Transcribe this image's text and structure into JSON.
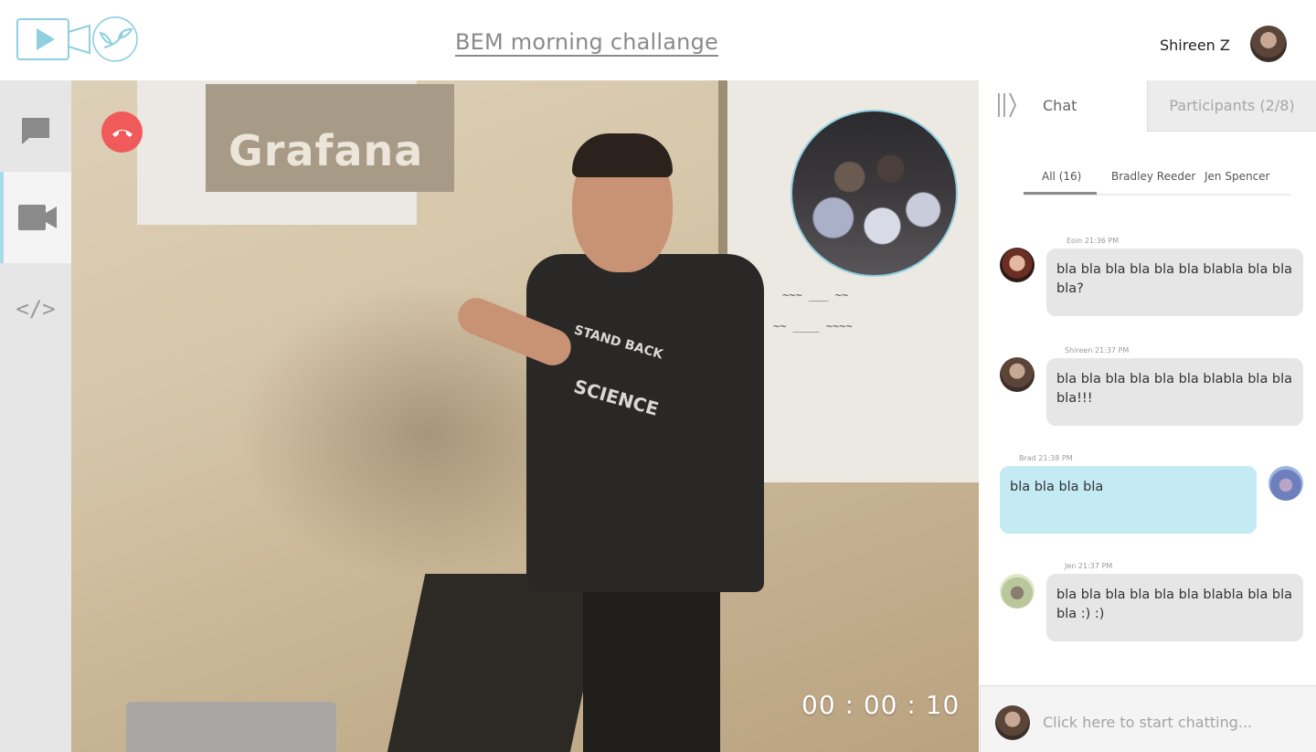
{
  "header": {
    "title": "BEM morning challange",
    "user_name": "Shireen Z"
  },
  "colors": {
    "accent": "#8ecfe0",
    "hangup": "#f05a5a",
    "outgoing_bubble": "#c4eaf3",
    "incoming_bubble": "#e6e6e6"
  },
  "rail": {
    "items": [
      {
        "name": "chat",
        "icon": "chat-bubble-icon"
      },
      {
        "name": "video",
        "icon": "video-camera-icon",
        "active": true
      },
      {
        "name": "code",
        "icon": "code-icon",
        "glyph": "</>"
      }
    ]
  },
  "stage": {
    "projection_text": "Grafana",
    "shirt_line1": "STAND BACK",
    "shirt_line2": "SCIENCE",
    "timer": "00 : 00 : 10"
  },
  "panel": {
    "tab_chat": "Chat",
    "tab_participants": "Participants (2/8)",
    "filters": {
      "all": "All (16)",
      "bradley": "Bradley Reeder",
      "jen": "Jen Spencer"
    },
    "messages": [
      {
        "author": "Eoin",
        "time": "21:36 PM",
        "meta": "Eoin  21:36 PM",
        "text": "bla bla bla  bla bla bla blabla bla bla bla?",
        "direction": "in"
      },
      {
        "author": "Shireen",
        "time": "21:37 PM",
        "meta": "Shireen  21:37 PM",
        "text": "bla bla bla  bla bla bla blabla bla bla bla!!!",
        "direction": "in"
      },
      {
        "author": "Brad",
        "time": "21:38 PM",
        "meta": "Brad  21:38 PM",
        "text": "bla bla bla bla",
        "direction": "out"
      },
      {
        "author": "Jen",
        "time": "21:37 PM",
        "meta": "Jen  21:37 PM",
        "text": "bla bla bla  bla bla bla blabla bla bla bla :) :)",
        "direction": "in"
      }
    ],
    "composer_placeholder": "Click here to start chatting..."
  }
}
